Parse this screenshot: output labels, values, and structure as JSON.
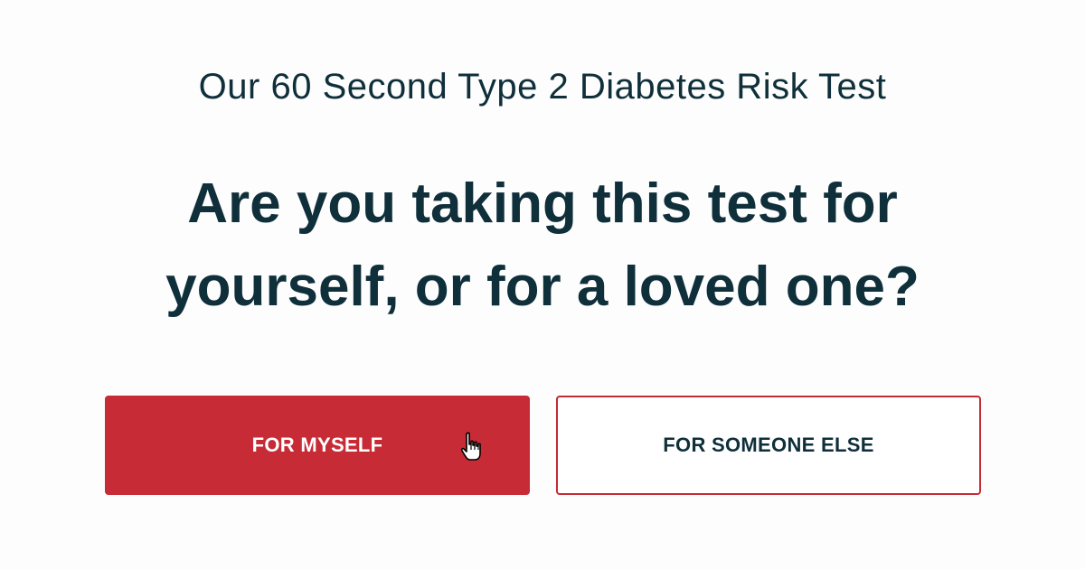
{
  "header": {
    "subtitle": "Our 60 Second Type 2 Diabetes Risk Test",
    "question": "Are you taking this test for yourself, or for a loved one?"
  },
  "options": {
    "myself_label": "FOR MYSELF",
    "someone_else_label": "FOR SOMEONE ELSE"
  },
  "colors": {
    "accent": "#c62b36",
    "text": "#0f2f3b",
    "background": "#fdfdfd"
  },
  "icons": {
    "pointer": "hand-pointer-icon"
  }
}
